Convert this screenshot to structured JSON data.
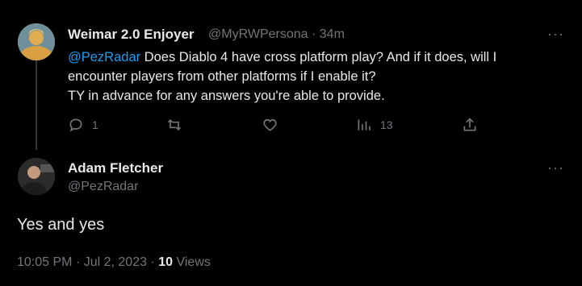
{
  "reply_to": {
    "author_name": "Weimar 2.0 Enjoyer",
    "handle": "@MyRWPersona",
    "separator": "·",
    "time_ago": "34m",
    "mention": "@PezRadar",
    "line1_rest": " Does Diablo 4 have cross platform play? And if it does, will I",
    "line2": "encounter players from other platforms if I enable it?",
    "line3": "TY in advance for any answers you're able to provide.",
    "more_label": "···",
    "actions": {
      "reply_count": "1",
      "repost_count": "",
      "like_count": "",
      "views_count": "13"
    },
    "icons": {
      "reply": "reply-icon",
      "repost": "repost-icon",
      "like": "heart-icon",
      "views": "views-chart-icon",
      "share": "share-icon"
    }
  },
  "main_tweet": {
    "author_name": "Adam Fletcher",
    "handle": "@PezRadar",
    "more_label": "···",
    "text": "Yes and yes",
    "time": "10:05 PM",
    "dot1": "·",
    "date": "Jul 2, 2023",
    "dot2": "·",
    "views_count": "10",
    "views_label": "Views"
  },
  "colors": {
    "background": "#000000",
    "text": "#e7e9ea",
    "muted": "#71767b",
    "mention": "#1d9bf0"
  }
}
